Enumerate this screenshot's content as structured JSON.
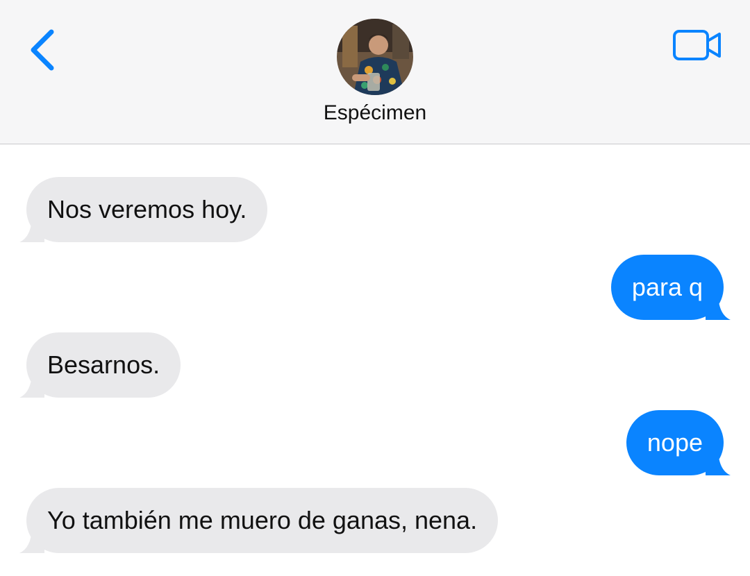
{
  "header": {
    "contact_name": "Espécimen",
    "back_icon": "chevron-left-icon",
    "video_icon": "video-camera-icon",
    "accent_color": "#0a84ff",
    "background_color": "#f6f6f7"
  },
  "messages": [
    {
      "direction": "incoming",
      "text": "Nos veremos hoy."
    },
    {
      "direction": "outgoing",
      "text": "para q"
    },
    {
      "direction": "incoming",
      "text": "Besarnos."
    },
    {
      "direction": "outgoing",
      "text": "nope"
    },
    {
      "direction": "incoming",
      "text": "Yo también me muero de ganas, nena."
    }
  ],
  "colors": {
    "incoming_bubble": "#e9e9eb",
    "outgoing_bubble": "#0a84ff",
    "incoming_text": "#111111",
    "outgoing_text": "#ffffff"
  }
}
